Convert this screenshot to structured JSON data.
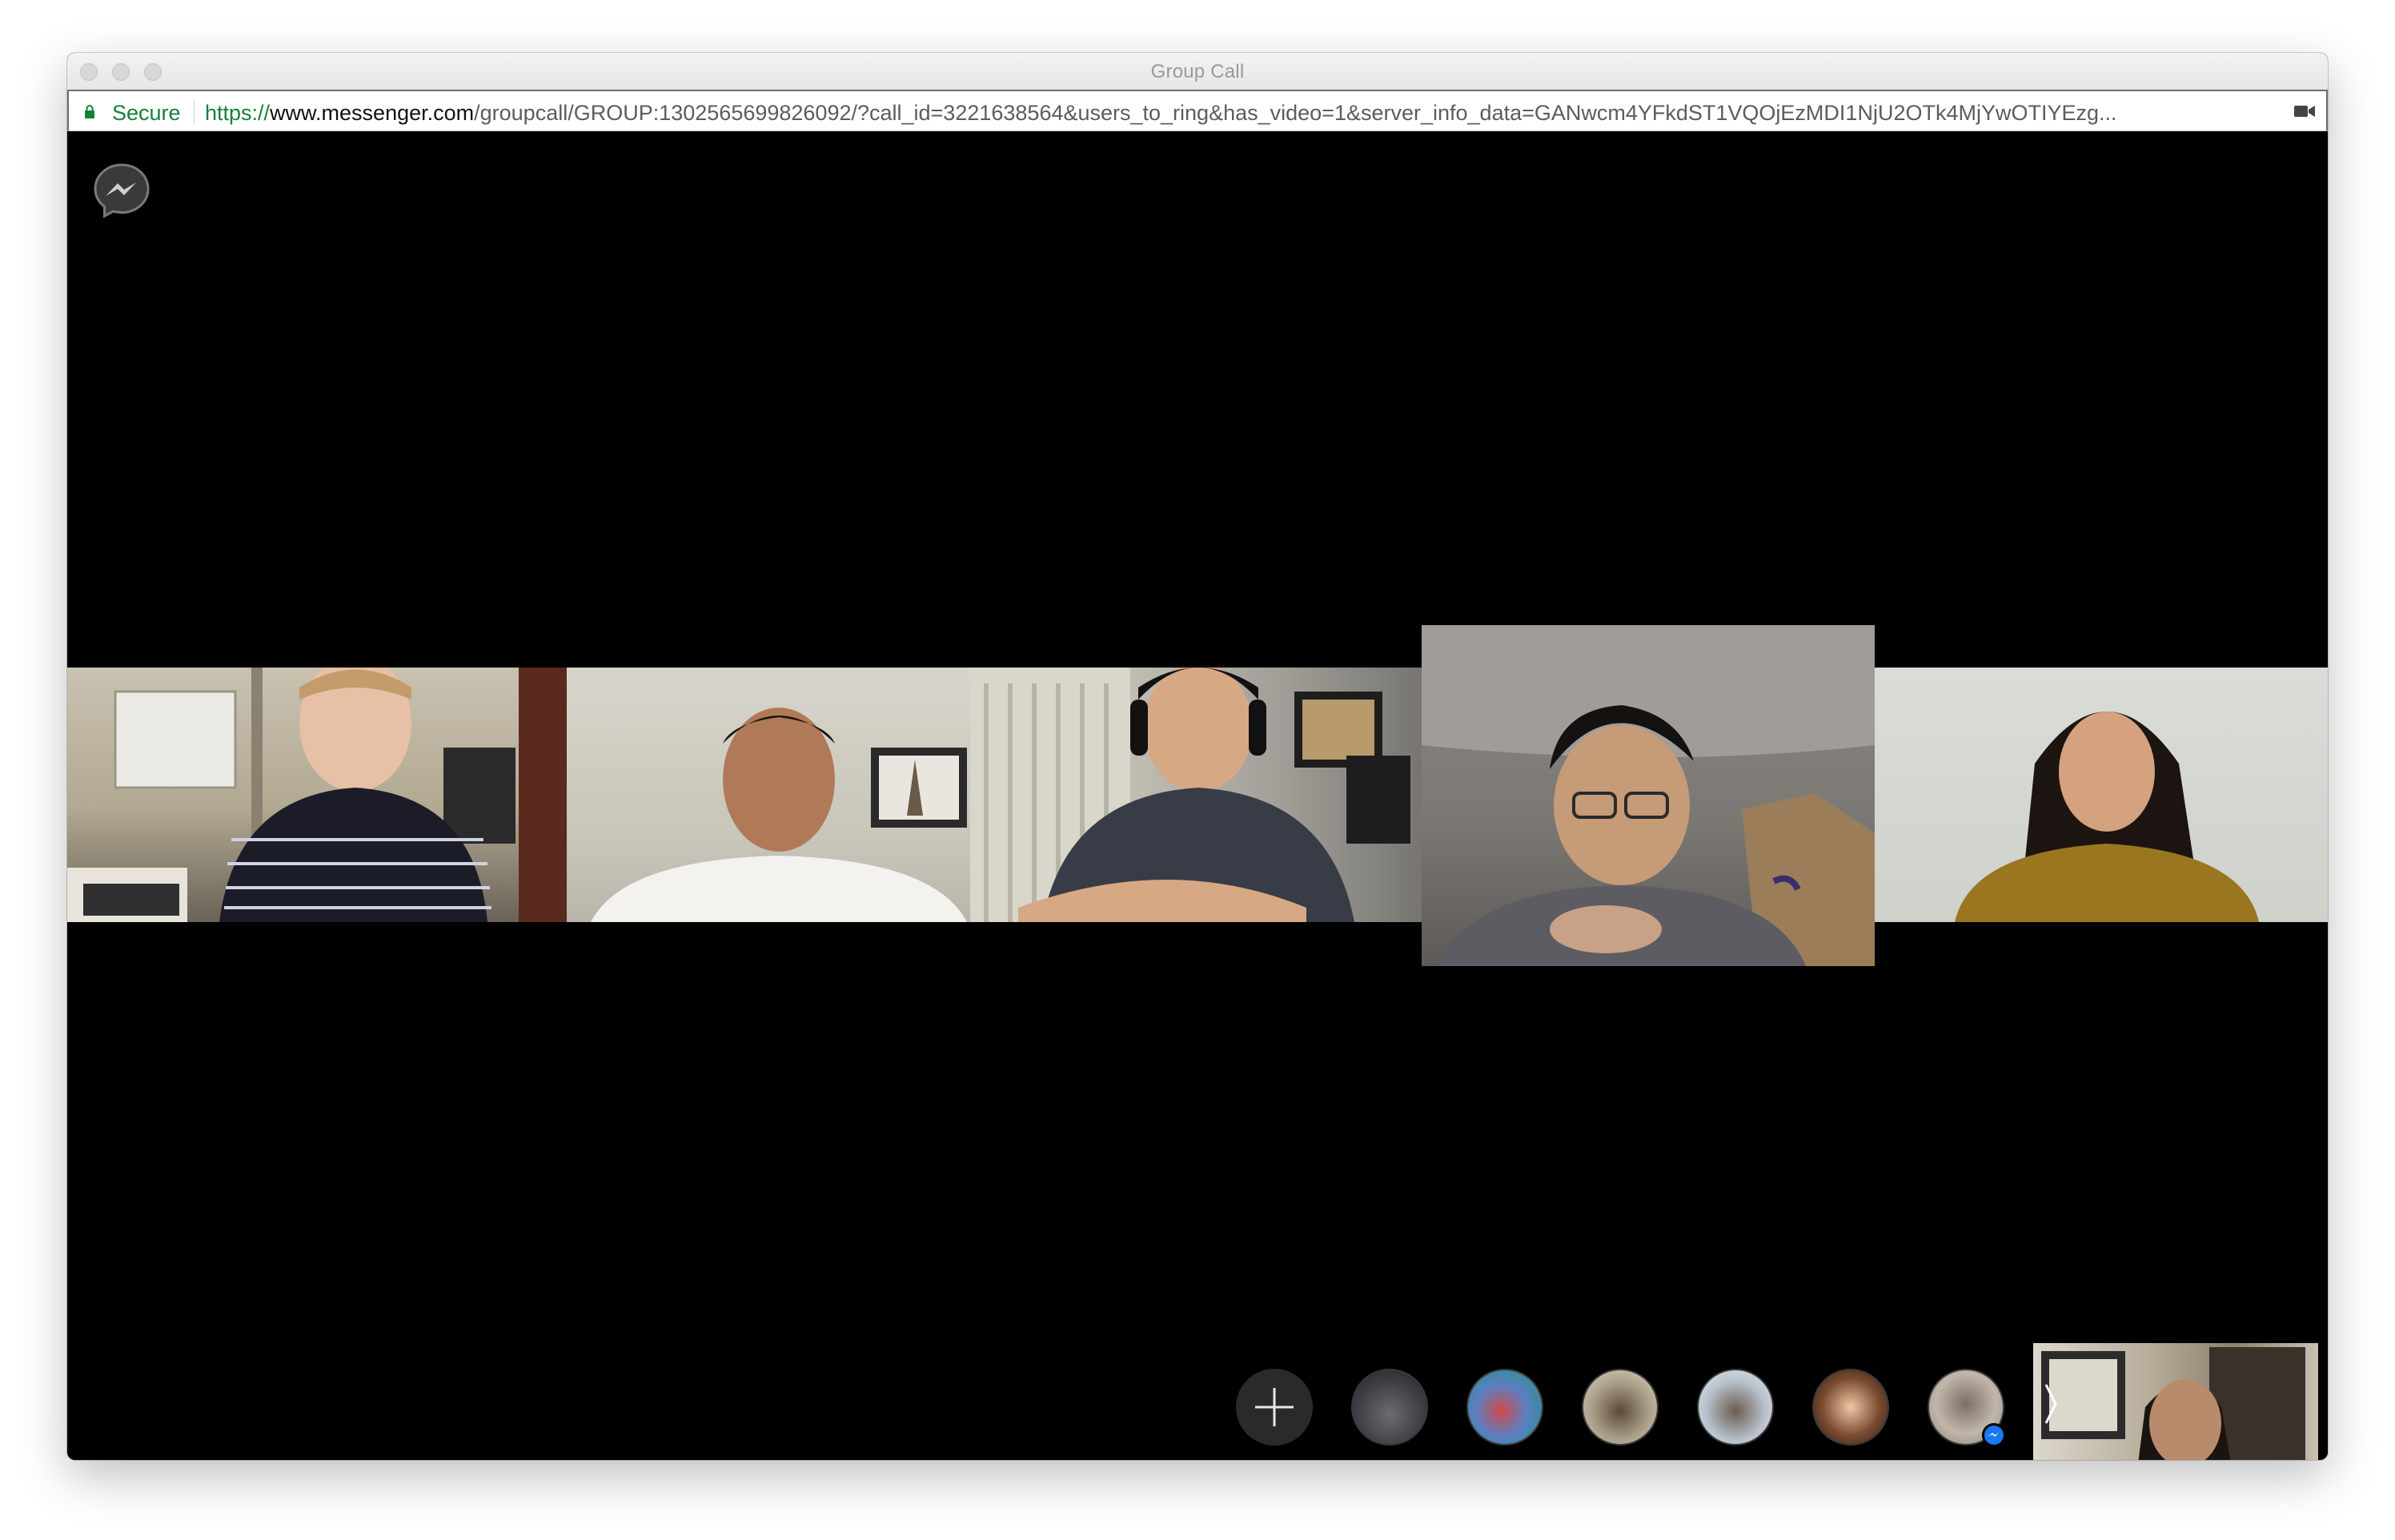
{
  "window": {
    "title": "Group Call"
  },
  "urlbar": {
    "secure_label": "Secure",
    "url_scheme": "https://",
    "url_host": "www.messenger.com",
    "url_path": "/groupcall/GROUP:1302565699826092/?call_id=3221638564&users_to_ring&has_video=1&server_info_data=GANwcm4YFkdST1VQOjEzMDI1NjU2OTk4MjYwOTIYEzg..."
  },
  "icons": {
    "lock": "lock-icon",
    "camera": "video-camera-icon",
    "messenger": "messenger-logo",
    "add": "plus-icon",
    "chevron": "chevron-right-icon"
  },
  "colors": {
    "secure_green": "#188038",
    "stage_bg": "#000000",
    "messenger_blue": "#1877f2"
  },
  "participants_main": [
    "participant-1",
    "participant-2",
    "participant-3",
    "participant-4",
    "participant-5"
  ],
  "participants_ringing": [
    "avatar-1",
    "avatar-2",
    "avatar-3",
    "avatar-4",
    "avatar-5",
    "avatar-6"
  ]
}
